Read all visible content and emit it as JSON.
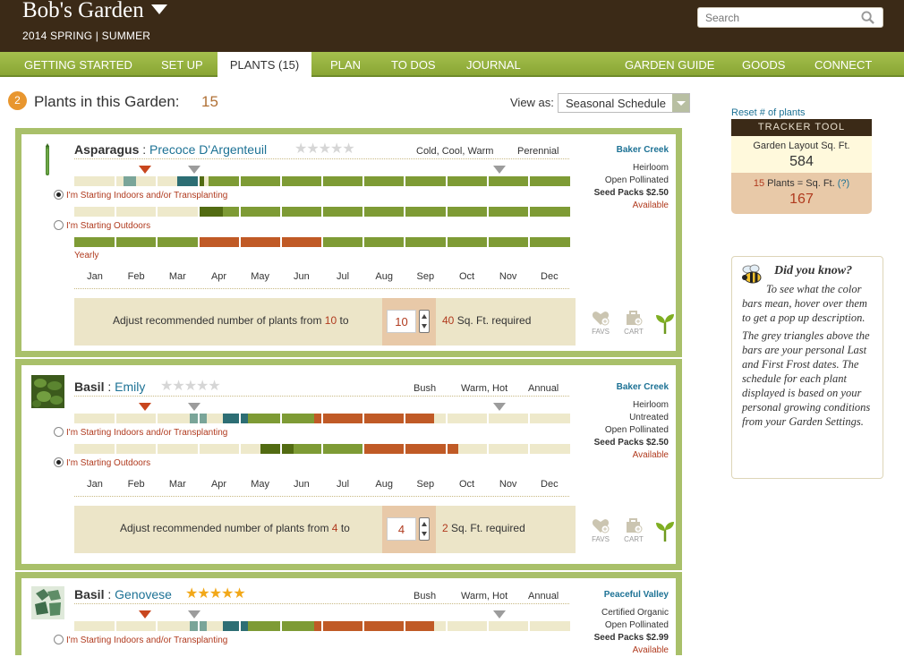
{
  "header": {
    "title": "Bob's Garden",
    "season": "2014 SPRING | SUMMER",
    "search_placeholder": "Search"
  },
  "nav": {
    "left": [
      "GETTING STARTED",
      "SET UP",
      "PLANTS (15)",
      "PLAN",
      "TO DOS",
      "JOURNAL"
    ],
    "right": [
      "GARDEN GUIDE",
      "GOODS",
      "CONNECT"
    ],
    "active": "PLANTS (15)"
  },
  "page": {
    "step": "2",
    "title": "Plants in this Garden:",
    "count": "15",
    "view_as_label": "View as:",
    "view_as_value": "Seasonal Schedule"
  },
  "months": [
    "Jan",
    "Feb",
    "Mar",
    "Apr",
    "May",
    "Jun",
    "Jul",
    "Aug",
    "Sep",
    "Oct",
    "Nov",
    "Dec"
  ],
  "options": {
    "indoors": "I'm Starting Indoors and/or Transplanting",
    "outdoors": "I'm Starting Outdoors",
    "yearly": "Yearly"
  },
  "adjust_text": {
    "prefix": "Adjust recommended number of plants from",
    "to": "to",
    "suffix": "Sq. Ft. required"
  },
  "actions": {
    "favs": "FAVS",
    "cart": "CART"
  },
  "colors": {
    "brown": "#3b2a17",
    "nav_green": "#94ae3f",
    "empty": "#eee9cb",
    "light_teal": "#7aa599",
    "dark_teal": "#2d6e74",
    "olive": "#7e9b35",
    "dark_olive": "#526b12",
    "rust": "#c05a26",
    "link": "#1d7295",
    "accent": "#b03a1e"
  },
  "plants": [
    {
      "name": "Asparagus",
      "variety": "Precoce D'Argenteuil",
      "rating": 0,
      "tags": [
        "Cold, Cool, Warm",
        "Perennial"
      ],
      "vendor": "Baker Creek",
      "meta": [
        "Heirloom",
        "Open Pollinated"
      ],
      "price": "Seed Packs $2.50",
      "available": "Available",
      "recommended": "10",
      "value": "10",
      "sqft": "40",
      "indoors_selected": true,
      "last_frost_month": 2.4,
      "first_frost_month": 10.3,
      "rows": [
        [
          [
            "empty",
            0,
            1.2
          ],
          [
            "light_teal",
            1.2,
            1.5
          ],
          [
            "empty",
            1.5,
            2.5
          ],
          [
            "dark_teal",
            2.5,
            3.0
          ],
          [
            "dark_olive",
            3.0,
            3.15
          ],
          [
            "empty",
            3.15,
            3.25
          ],
          [
            "olive",
            3.25,
            12
          ]
        ],
        [
          [
            "empty",
            0,
            3.0
          ],
          [
            "dark_olive",
            3.0,
            3.6
          ],
          [
            "olive",
            3.6,
            12
          ]
        ],
        [
          [
            "olive",
            0,
            3.0
          ],
          [
            "rust",
            3.0,
            6.0
          ],
          [
            "olive",
            6.0,
            12
          ]
        ]
      ],
      "yearly": true
    },
    {
      "name": "Basil",
      "variety": "Emily",
      "rating": 0,
      "tags": [
        "Bush",
        "Warm, Hot",
        "Annual"
      ],
      "vendor": "Baker Creek",
      "meta": [
        "Heirloom",
        "Untreated",
        "Open Pollinated"
      ],
      "price": "Seed Packs $2.50",
      "available": "Available",
      "recommended": "4",
      "value": "4",
      "sqft": "2",
      "indoors_selected": false,
      "last_frost_month": 2.4,
      "first_frost_month": 10.3,
      "rows": [
        [
          [
            "empty",
            0,
            2.8
          ],
          [
            "light_teal",
            2.8,
            3.2
          ],
          [
            "empty",
            3.2,
            3.6
          ],
          [
            "dark_teal",
            3.6,
            4.2
          ],
          [
            "olive",
            4.2,
            5.8
          ],
          [
            "rust",
            5.8,
            8.7
          ],
          [
            "empty",
            8.7,
            12
          ]
        ],
        [
          [
            "empty",
            0,
            4.5
          ],
          [
            "dark_olive",
            4.5,
            5.3
          ],
          [
            "olive",
            5.3,
            7.0
          ],
          [
            "rust",
            7.0,
            9.3
          ],
          [
            "empty",
            9.3,
            12
          ]
        ]
      ],
      "yearly": false
    },
    {
      "name": "Basil",
      "variety": "Genovese",
      "rating": 5,
      "tags": [
        "Bush",
        "Warm, Hot",
        "Annual"
      ],
      "vendor": "Peaceful Valley",
      "meta": [
        "Certified Organic",
        "Open Pollinated"
      ],
      "price": "Seed Packs $2.99",
      "available": "Available",
      "recommended": "",
      "value": "",
      "sqft": "",
      "indoors_selected": false,
      "last_frost_month": 2.4,
      "first_frost_month": 10.3,
      "rows": [
        [
          [
            "empty",
            0,
            2.8
          ],
          [
            "light_teal",
            2.8,
            3.2
          ],
          [
            "empty",
            3.2,
            3.6
          ],
          [
            "dark_teal",
            3.6,
            4.2
          ],
          [
            "olive",
            4.2,
            5.8
          ],
          [
            "rust",
            5.8,
            8.7
          ],
          [
            "empty",
            8.7,
            12
          ]
        ]
      ],
      "yearly": false
    }
  ],
  "tracker": {
    "reset_link": "Reset # of plants",
    "title": "TRACKER TOOL",
    "layout_label": "Garden Layout Sq. Ft.",
    "layout_value": "584",
    "plants_label_num": "15",
    "plants_label": "Plants = Sq. Ft.",
    "help": "(?)",
    "plants_value": "167"
  },
  "did_you_know": {
    "title": "Did you know?",
    "p1": "To see what the color bars mean, hover over them to get a pop up description.",
    "p2": "The grey triangles above the bars are your personal Last and First Frost dates. The schedule for each plant displayed is based on your personal growing conditions from your Garden Settings."
  }
}
